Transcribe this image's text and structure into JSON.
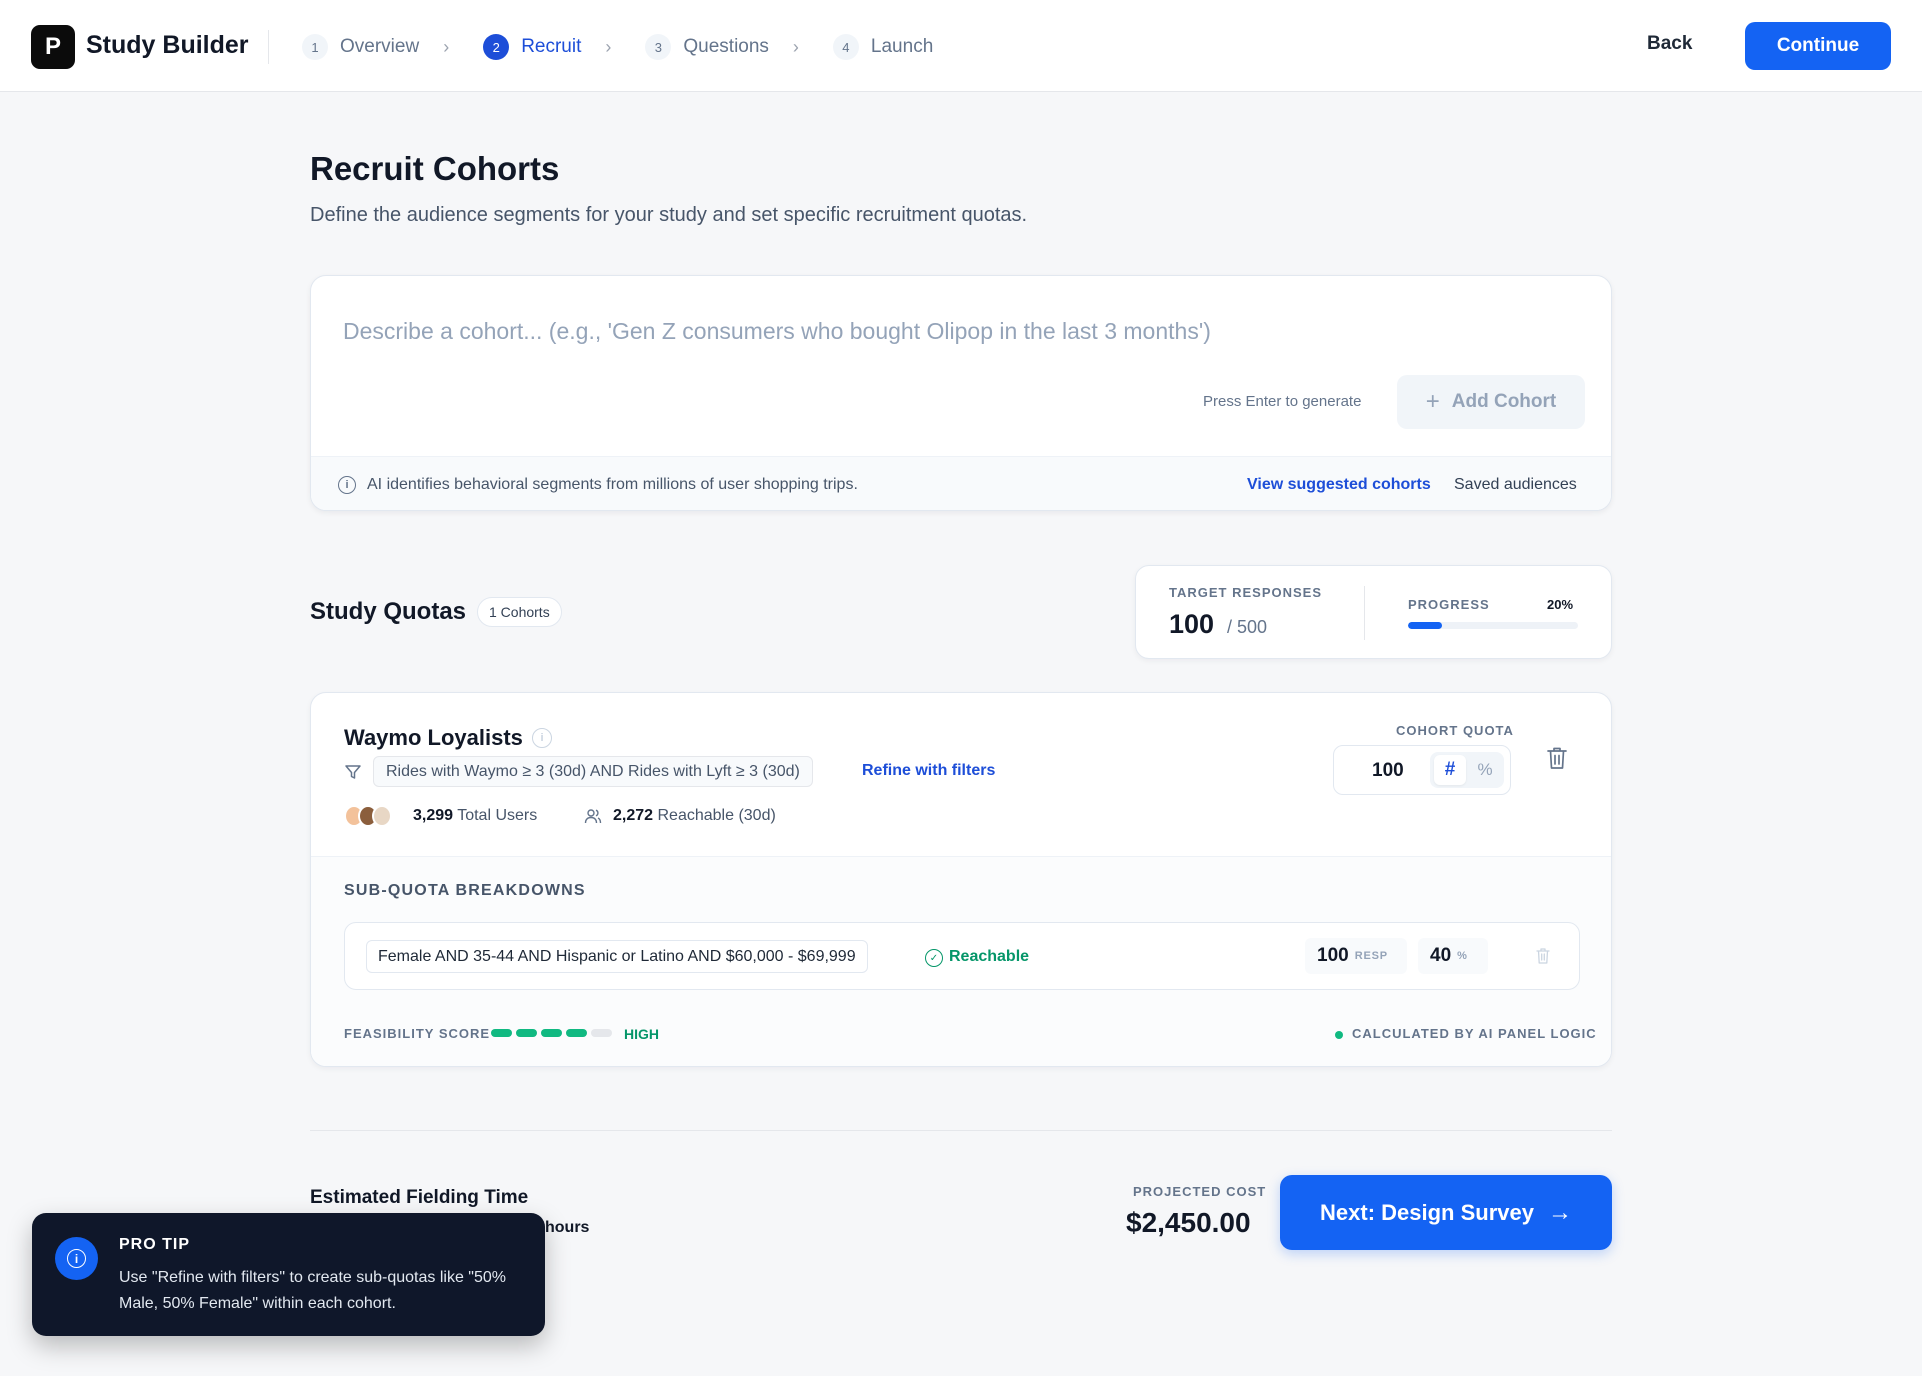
{
  "header": {
    "logo_letter": "P",
    "app_title": "Study Builder",
    "steps": [
      {
        "num": "1",
        "label": "Overview"
      },
      {
        "num": "2",
        "label": "Recruit"
      },
      {
        "num": "3",
        "label": "Questions"
      },
      {
        "num": "4",
        "label": "Launch"
      }
    ],
    "active_step": 2,
    "back_label": "Back",
    "continue_label": "Continue"
  },
  "page": {
    "title": "Recruit Cohorts",
    "subtitle": "Define the audience segments for your study and set specific recruitment quotas."
  },
  "describe": {
    "placeholder": "Describe a cohort... (e.g., 'Gen Z consumers who bought Olipop in the last 3 months')",
    "value": "",
    "hint": "Press Enter to generate",
    "add_label": "Add Cohort",
    "footer_note": "AI identifies behavioral segments from millions of user shopping trips.",
    "view_suggested": "View suggested cohorts",
    "saved_audiences": "Saved audiences"
  },
  "quotas": {
    "title": "Study Quotas",
    "badge": "1 Cohorts",
    "target_label": "TARGET RESPONSES",
    "target_value": "100",
    "target_of": "/ 500",
    "progress_label": "PROGRESS",
    "progress_pct_text": "20%",
    "progress_fraction": 0.2
  },
  "cohort": {
    "name": "Waymo Loyalists",
    "filter": "Rides with Waymo ≥ 3 (30d) AND Rides with Lyft ≥ 3 (30d)",
    "refine": "Refine with filters",
    "total_users_num": "3,299",
    "total_users_label": "Total Users",
    "reachable_num": "2,272",
    "reachable_label": "Reachable (30d)",
    "quota_label": "COHORT QUOTA",
    "quota_value": "100",
    "quota_hash": "#",
    "quota_pct": "%",
    "sub_title": "SUB-QUOTA BREAKDOWNS",
    "sub_quotas": [
      {
        "criteria": "Female AND 35-44 AND Hispanic or Latino AND $60,000 - $69,999",
        "status": "Reachable",
        "resp": "100",
        "resp_unit": "RESP",
        "pct": "40",
        "pct_unit": "%"
      }
    ],
    "feasibility_label": "FEASIBILITY SCORE",
    "feasibility_level": "HIGH",
    "feasibility_bars_on": 4,
    "feasibility_bars_total": 5,
    "calc_label": "CALCULATED BY AI PANEL LOGIC"
  },
  "footer": {
    "est_label": "Estimated Fielding Time",
    "est_value_visible": "hours",
    "projected_label": "PROJECTED COST",
    "projected_value": "$2,450.00",
    "next_label": "Next: Design Survey"
  },
  "pro_tip": {
    "title": "PRO TIP",
    "body": "Use \"Refine with filters\" to create sub-quotas like \"50% Male, 50% Female\" within each cohort."
  },
  "colors": {
    "primary": "#1463f3",
    "success": "#059669",
    "tip_bg": "#0f172a"
  }
}
